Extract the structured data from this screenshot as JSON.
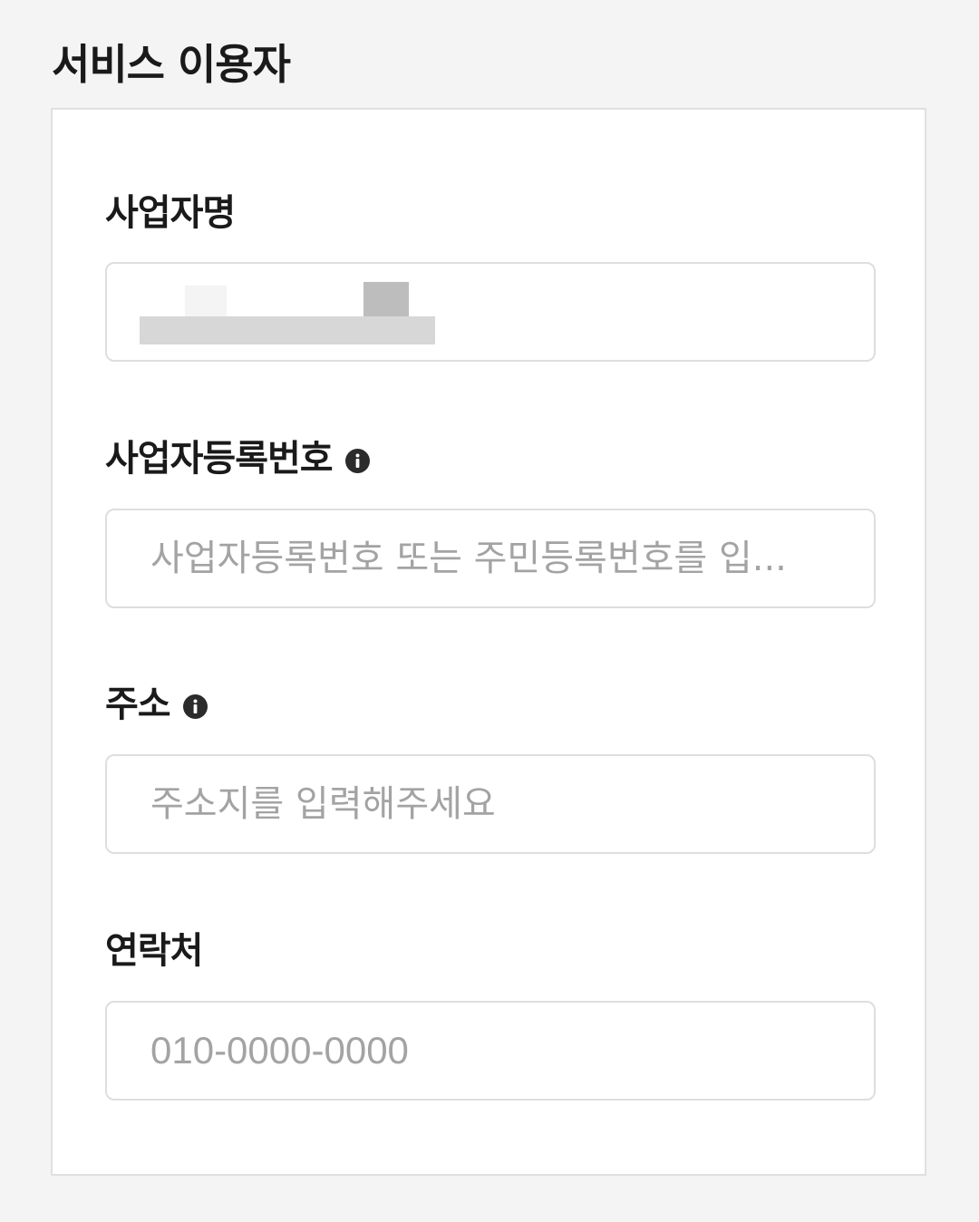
{
  "section": {
    "title": "서비스 이용자"
  },
  "fields": {
    "business_name": {
      "label": "사업자명"
    },
    "registration_number": {
      "label": "사업자등록번호",
      "placeholder": "사업자등록번호 또는 주민등록번호를 입...",
      "icon": "info-icon"
    },
    "address": {
      "label": "주소",
      "placeholder": "주소지를 입력해주세요",
      "icon": "info-icon"
    },
    "contact": {
      "label": "연락처",
      "placeholder": "010-0000-0000"
    }
  },
  "colors": {
    "page_background": "#f4f4f4",
    "card_background": "#ffffff",
    "border": "#dedede",
    "placeholder": "#a3a3a3",
    "icon": "#2b2b2b"
  }
}
